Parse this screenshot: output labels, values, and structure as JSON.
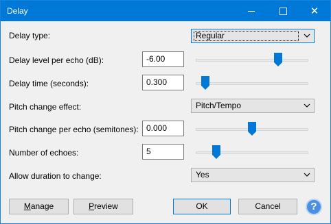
{
  "window": {
    "title": "Delay",
    "minimize_icon": "minimize-icon",
    "maximize_icon": "maximize-icon",
    "close_icon": "close-icon"
  },
  "form": {
    "delay_type": {
      "label": "Delay type:",
      "value": "Regular"
    },
    "delay_level": {
      "label": "Delay level per echo (dB):",
      "value": "-6.00",
      "slider_fraction": 0.75
    },
    "delay_time": {
      "label": "Delay time (seconds):",
      "value": "0.300",
      "slider_fraction": 0.05
    },
    "pitch_effect": {
      "label": "Pitch change effect:",
      "value": "Pitch/Tempo"
    },
    "pitch_change": {
      "label": "Pitch change per echo (semitones):",
      "value": "0.000",
      "slider_fraction": 0.5
    },
    "echoes": {
      "label": "Number of echoes:",
      "value": "5",
      "slider_fraction": 0.16
    },
    "allow_duration": {
      "label": "Allow duration to change:",
      "value": "Yes"
    }
  },
  "buttons": {
    "manage_prefix": "M",
    "manage_rest": "anage",
    "preview_prefix": "P",
    "preview_rest": "review",
    "ok": "OK",
    "cancel": "Cancel",
    "help": "?"
  },
  "colors": {
    "titlebar": "#0078d7",
    "slider_thumb": "#0078d7",
    "help_button": "#4a8fe0"
  }
}
